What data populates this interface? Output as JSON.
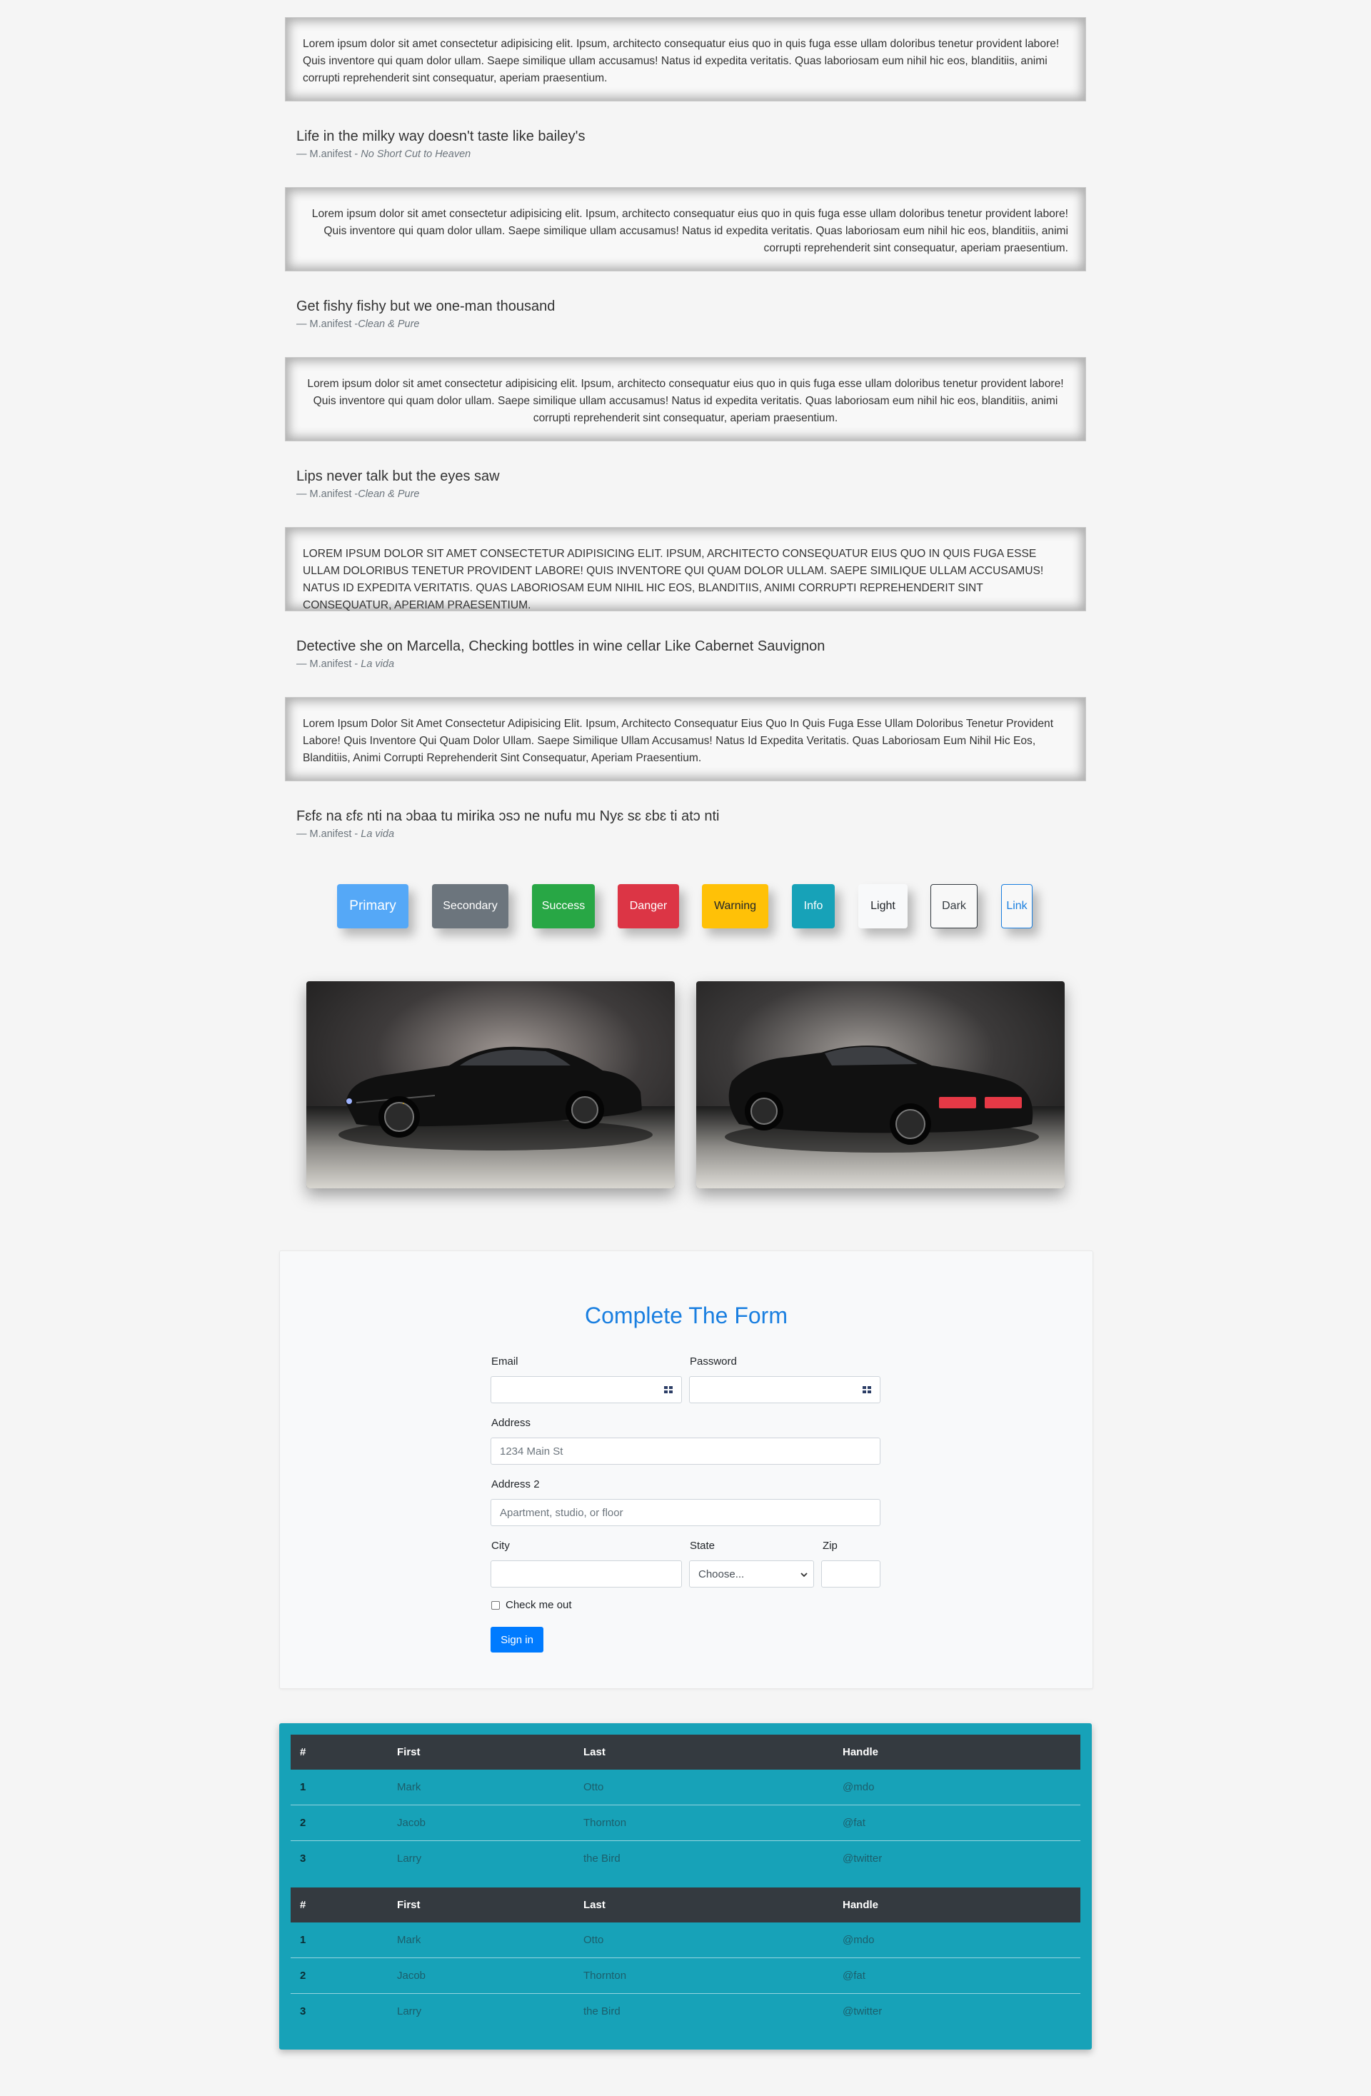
{
  "quotes": [
    {
      "paragraph": "Lorem ipsum dolor sit amet consectetur adipisicing elit. Ipsum, architecto consequatur eius quo in quis fuga esse ullam doloribus tenetur provident labore! Quis inventore qui quam dolor ullam. Saepe similique ullam accusamus! Natus id expedita veritatis. Quas laboriosam eum nihil hic eos, blanditiis, animi corrupti reprehenderit sint consequatur, aperiam praesentium.",
      "title": "Life in the milky way doesn't taste like bailey's",
      "author": "— M.anifest - ",
      "source": "No Short Cut to Heaven"
    },
    {
      "paragraph": "Lorem ipsum dolor sit amet consectetur adipisicing elit. Ipsum, architecto consequatur eius quo in quis fuga esse ullam doloribus tenetur provident labore! Quis inventore qui quam dolor ullam. Saepe similique ullam accusamus! Natus id expedita veritatis. Quas laboriosam eum nihil hic eos, blanditiis, animi corrupti reprehenderit sint consequatur, aperiam praesentium.",
      "title": "Get fishy fishy but we one-man thousand",
      "author": "— M.anifest -",
      "source": "Clean & Pure"
    },
    {
      "paragraph": "Lorem ipsum dolor sit amet consectetur adipisicing elit. Ipsum, architecto consequatur eius quo in quis fuga esse ullam doloribus tenetur provident labore! Quis inventore qui quam dolor ullam. Saepe similique ullam accusamus! Natus id expedita veritatis. Quas laboriosam eum nihil hic eos, blanditiis, animi corrupti reprehenderit sint consequatur, aperiam praesentium.",
      "title": "Lips never talk but the eyes saw",
      "author": "— M.anifest -",
      "source": "Clean & Pure"
    },
    {
      "paragraph": "Lorem ipsum dolor sit amet consectetur adipisicing elit. Ipsum, architecto consequatur eius quo in quis fuga esse ullam doloribus tenetur provident labore! Quis inventore qui quam dolor ullam. Saepe similique ullam accusamus! Natus id expedita veritatis. Quas laboriosam eum nihil hic eos, blanditiis, animi corrupti reprehenderit sint consequatur, aperiam praesentium.",
      "title": "Detective she on Marcella, Checking bottles in wine cellar Like Cabernet Sauvignon",
      "author": "— M.anifest - ",
      "source": "La vida"
    },
    {
      "paragraph": "Lorem ipsum dolor sit amet consectetur adipisicing elit. Ipsum, architecto consequatur eius quo in quis fuga esse ullam doloribus tenetur provident labore! Quis inventore qui quam dolor ullam. Saepe similique ullam accusamus! Natus id expedita veritatis. Quas laboriosam eum nihil hic eos, blanditiis, animi corrupti reprehenderit sint consequatur, aperiam praesentium.",
      "title": "Fɛfɛ na ɛfɛ nti na ɔbaa tu mirika ɔsɔ ne nufu mu Nyɛ sɛ ɛbɛ ti atɔ nti",
      "author": "— M.anifest - ",
      "source": "La vida"
    }
  ],
  "buttons": {
    "primary": "Primary",
    "secondary": "Secondary",
    "success": "Success",
    "danger": "Danger",
    "warning": "Warning",
    "info": "Info",
    "light": "Light",
    "dark": "Dark",
    "link": "Link"
  },
  "colors": {
    "primary": "#55a8f7",
    "secondary": "#6c757d",
    "success": "#28a745",
    "danger": "#dc3545",
    "warning": "#ffc107",
    "info": "#17a2b8",
    "dark_header": "#343a40",
    "form_title": "#1a7fe0"
  },
  "form": {
    "title": "Complete The Form",
    "email_label": "Email",
    "password_label": "Password",
    "address_label": "Address",
    "address_placeholder": "1234 Main St",
    "address2_label": "Address 2",
    "address2_placeholder": "Apartment, studio, or floor",
    "city_label": "City",
    "state_label": "State",
    "state_selected": "Choose...",
    "zip_label": "Zip",
    "checkbox_label": "Check me out",
    "submit_label": "Sign in"
  },
  "table": {
    "headers": [
      "#",
      "First",
      "Last",
      "Handle"
    ],
    "rows": [
      [
        "1",
        "Mark",
        "Otto",
        "@mdo"
      ],
      [
        "2",
        "Jacob",
        "Thornton",
        "@fat"
      ],
      [
        "3",
        "Larry",
        "the Bird",
        "@twitter"
      ]
    ]
  }
}
